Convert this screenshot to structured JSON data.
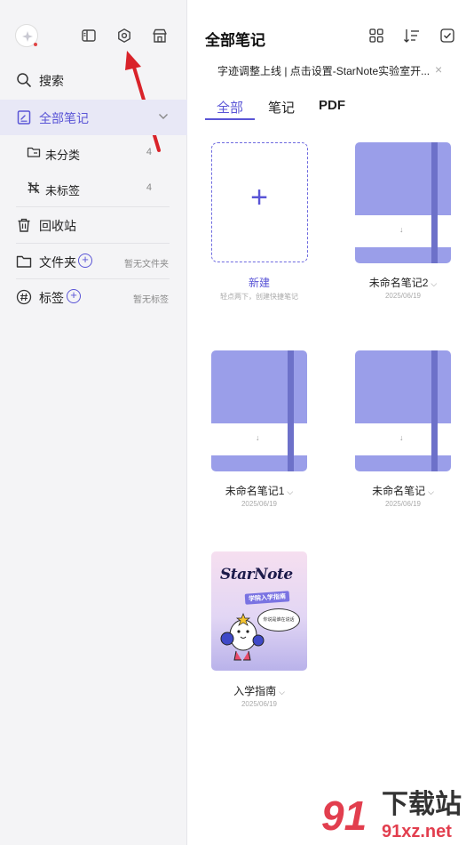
{
  "sidebar": {
    "top_icons": [
      "avatar-logo",
      "sidebar-toggle-icon",
      "settings-icon",
      "store-icon"
    ],
    "search": "搜索",
    "all_notes": "全部笔记",
    "uncategorized": "未分类",
    "uncategorized_count": "4",
    "untagged": "未标签",
    "untagged_count": "4",
    "trash": "回收站",
    "folders": "文件夹",
    "folders_hint": "暂无文件夹",
    "tags": "标签",
    "tags_hint": "暂无标签"
  },
  "header": {
    "title": "全部笔记",
    "banner": "字迹调整上线 | 点击设置-StarNote实验室开...",
    "banner_close": "×",
    "tabs": [
      "全部",
      "笔记",
      "PDF"
    ],
    "active_tab": "全部"
  },
  "new_note": {
    "plus": "+",
    "label": "新建",
    "hint": "轻点两下，创建快捷笔记"
  },
  "notebooks": [
    {
      "title": "未命名笔记2",
      "date": "2025/06/19"
    },
    {
      "title": "未命名笔记1",
      "date": "2025/06/19"
    },
    {
      "title": "未命名笔记",
      "date": "2025/06/19"
    },
    {
      "title": "入学指南",
      "date": "2025/06/19"
    }
  ],
  "guide_cover": {
    "logo": "StarNote",
    "badge": "学院入学指南",
    "bubble": "你说是谁在说话"
  },
  "watermark": {
    "main": "下载站",
    "sub": "91xz.net",
    "logo": "91"
  },
  "colors": {
    "accent": "#5a55d6",
    "notebook": "#9a9ee9",
    "spine": "#6d71c9",
    "annotation": "#d9232a"
  }
}
